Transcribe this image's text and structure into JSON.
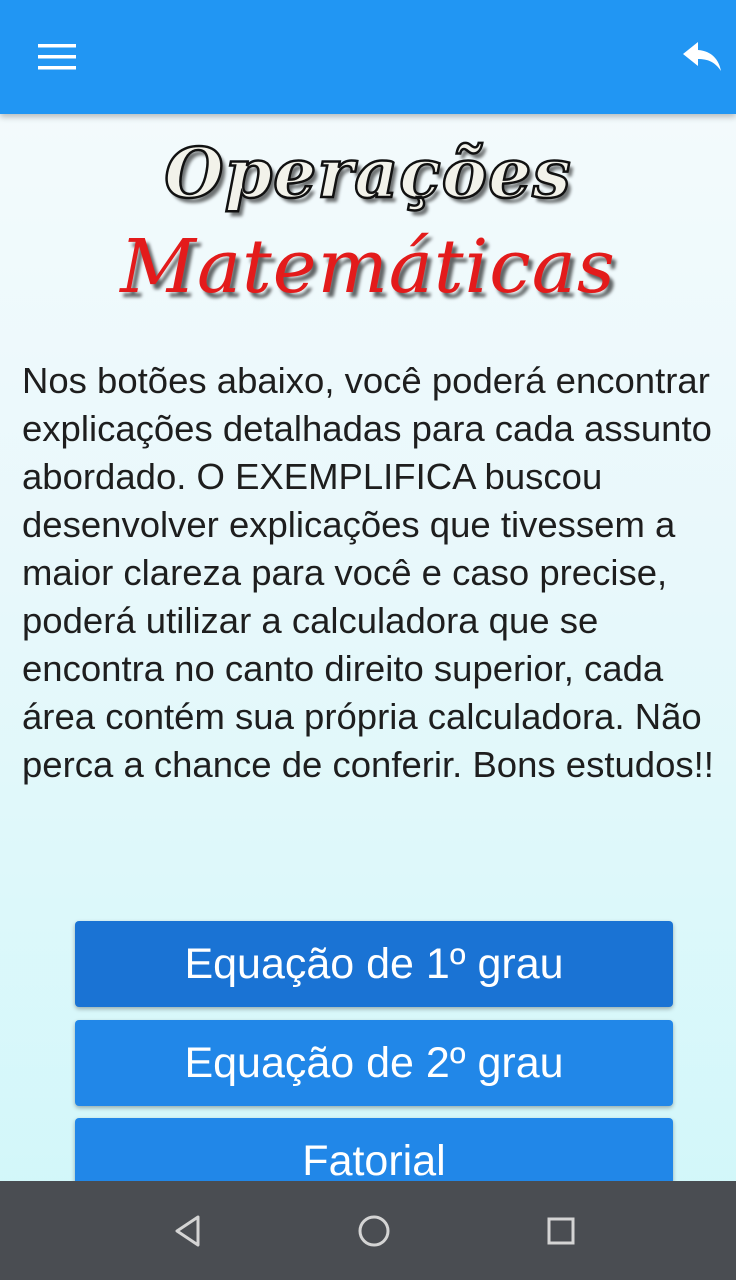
{
  "app_bar": {
    "color": "#2196f3",
    "menu_icon": "hamburger-menu-icon",
    "back_icon": "reply-arrow-icon"
  },
  "logo": {
    "line1": "Operações",
    "line2": "Matemáticas"
  },
  "intro_text": "Nos botões abaixo, você poderá encontrar explicações detalhadas para cada assunto abordado. O EXEMPLIFICA buscou desenvolver explicações que tivessem a maior clareza para você e caso precise, poderá utilizar a calculadora que se encontra no canto direito superior, cada área contém sua própria calculadora. Não perca a chance de conferir. Bons estudos!!",
  "buttons": [
    {
      "label": "Equação de 1º grau"
    },
    {
      "label": "Equação de 2º grau"
    },
    {
      "label": "Fatorial"
    }
  ],
  "nav_bar": {
    "back_icon": "triangle-back-icon",
    "home_icon": "circle-home-icon",
    "recents_icon": "square-recents-icon"
  }
}
